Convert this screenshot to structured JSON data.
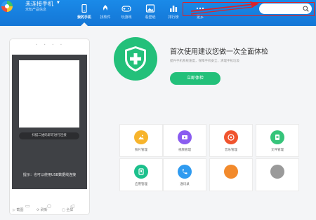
{
  "app": {
    "title": "未连接手机",
    "caret": "▼",
    "subtitle": "未知产品信息"
  },
  "nav": {
    "items": [
      {
        "label": "我的手机",
        "icon": "phone-icon",
        "active": true
      },
      {
        "label": "找软件",
        "icon": "app-store-icon",
        "active": false
      },
      {
        "label": "玩游戏",
        "icon": "gamepad-icon",
        "active": false
      },
      {
        "label": "看壁纸",
        "icon": "wallpaper-icon",
        "active": false
      },
      {
        "label": "排行榜",
        "icon": "chart-icon",
        "active": false
      },
      {
        "label": "更多",
        "icon": "more-icon",
        "active": false
      }
    ]
  },
  "search": {
    "placeholder": "",
    "icon": "search-icon"
  },
  "phone_panel": {
    "scan_text": "扫描二维码即可进行连接",
    "usb_hint": "提示：也可以使用USB数据线连接",
    "keys": [
      "▭",
      "○",
      "◁"
    ],
    "tools": {
      "screenshot": "截图",
      "refresh": "刷新",
      "fullscreen": "全屏"
    }
  },
  "health_check": {
    "icon": "shield-plus-icon",
    "title": "首次使用建议您做一次全面体检",
    "description": "提升手机系统速度，保障手机安全，清理手机垃圾",
    "button": "立即体检"
  },
  "tiles": [
    {
      "label": "照片管理",
      "icon": "photo-icon",
      "color": "#f7b42c"
    },
    {
      "label": "视频管理",
      "icon": "video-icon",
      "color": "#8a5cf0"
    },
    {
      "label": "音乐管理",
      "icon": "music-icon",
      "color": "#f0542e"
    },
    {
      "label": "文件管理",
      "icon": "folder-icon",
      "color": "#36c47a"
    },
    {
      "label": "应用管理",
      "icon": "apps-icon",
      "color": "#1cc08c"
    },
    {
      "label": "通讯录",
      "icon": "contacts-icon",
      "color": "#2f9bf0"
    },
    {
      "label": "",
      "icon": "tool-icon",
      "color": "#f28a2c"
    },
    {
      "label": "",
      "icon": "more-tools-icon",
      "color": "#9a9a9a"
    }
  ],
  "colors": {
    "nav_blue": "#1476d6",
    "accent_green": "#23c07a",
    "highlight_red": "#d8242c"
  }
}
